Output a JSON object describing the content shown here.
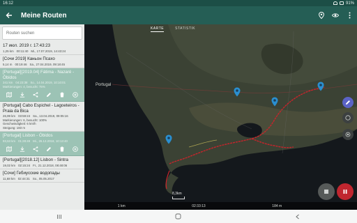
{
  "status": {
    "time": "16:12",
    "battery": "91%"
  },
  "header": {
    "title": "Meine Routen",
    "back_icon": "arrow-left-icon",
    "actions": [
      "map-pin-icon",
      "eye-icon",
      "more-vert-icon"
    ]
  },
  "search": {
    "placeholder": "Routen suchen"
  },
  "routes": [
    {
      "name": "17 июл. 2019 г. 17:43:23",
      "meta": [
        "1,25 km",
        "00:11:40",
        "Mi., 17.07.2019, 14:43:24"
      ],
      "highlighted": false
    },
    {
      "name": "[Сочи 2019] Каньон Псахо",
      "meta": [
        "5,14 m",
        "00:19:46",
        "Sa., 27.04.2019, 09:18:45"
      ],
      "highlighted": false
    },
    {
      "name": "[Portugal][2019.04] Fátima - Nazaré - Óbidos",
      "meta": [
        "341 km",
        "04:23:38",
        "So., 14.04.2019, 10:10:01",
        "Markierungen: 4, besucht: 75%"
      ],
      "highlighted": true
    },
    {
      "name": "[Portugal] Cabo Espichel - Lagoeteiros - Praia da Bica",
      "meta": [
        "26,99 km",
        "03:59:24",
        "Sa., 13.04.2019, 09:05:16",
        "Markierungen: 6, besucht: 100%",
        "Geschwindigkeit: 6 km/h",
        "Steigung: 183 m"
      ],
      "highlighted": false
    },
    {
      "name": "[Portugal] Lisbon - Óbidos",
      "meta": [
        "93,53 km",
        "01:28:49",
        "Mi., 26.12.2018, 10:13:40"
      ],
      "highlighted": true
    },
    {
      "name": "[Portugal][2018.12] Lisbon - Sintra",
      "meta": [
        "19,02 km",
        "02:15:24",
        "Fr., 21.12.2018, 08:48:06"
      ],
      "highlighted": false
    },
    {
      "name": "[Сочи] Гебиусские водопады",
      "meta": [
        "11,68 km",
        "02:44:31",
        "So., 05.05.2017"
      ],
      "highlighted": false
    }
  ],
  "route_toolbar": [
    "map-icon",
    "download-icon",
    "share-icon",
    "edit-icon",
    "delete-icon",
    "add-circle-icon"
  ],
  "map": {
    "tabs": [
      "KARTE",
      "STATISTIK"
    ],
    "active_tab": "KARTE",
    "place_label": "Portugal",
    "scale_label": "8,3km",
    "stats": [
      "1 km",
      "02:33:13",
      "184 m"
    ],
    "route_color": "#c8242b",
    "accent": "#2a8fd0"
  },
  "nav": [
    "menu-recent-icon",
    "home-circle-icon",
    "back-chevron-icon"
  ]
}
